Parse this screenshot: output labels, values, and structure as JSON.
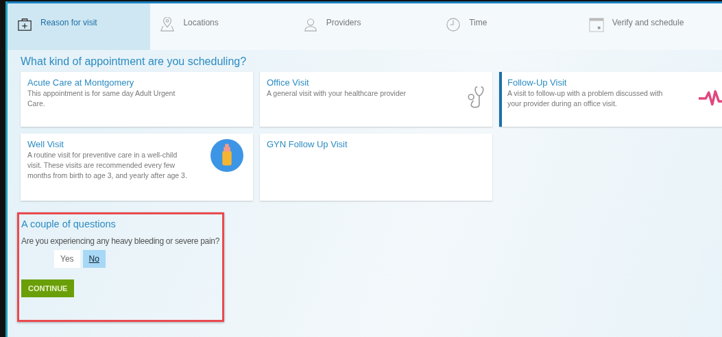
{
  "tabs": [
    {
      "label": "Reason for visit",
      "kind": "kit",
      "selected": true
    },
    {
      "label": "Locations",
      "kind": "pin",
      "selected": false
    },
    {
      "label": "Providers",
      "kind": "person",
      "selected": false
    },
    {
      "label": "Time",
      "kind": "clock",
      "selected": false
    },
    {
      "label": "Verify and schedule",
      "kind": "calendar",
      "selected": false
    }
  ],
  "heading": "What kind of appointment are you scheduling?",
  "appointment_types": [
    {
      "title": "Acute Care at Montgomery",
      "description": "This appointment is for same day Adult Urgent Care.",
      "kind": "plain",
      "selected": false
    },
    {
      "title": "Office Visit",
      "description": "A general visit with your healthcare provider",
      "kind": "stethoscope",
      "selected": false
    },
    {
      "title": "Follow-Up Visit",
      "description": "A visit to follow-up with a problem discussed with your provider during an office visit.",
      "kind": "pulse",
      "selected": true
    },
    {
      "title": "Well Visit",
      "description": "A routine visit for preventive care in a well-child visit. These visits are recommended every few months from birth to age 3, and yearly after age 3.",
      "kind": "bottle",
      "selected": false
    },
    {
      "title": "GYN Follow Up Visit",
      "kind": "plain",
      "selected": false
    }
  ],
  "questions": {
    "title": "A couple of questions",
    "question": "Are you experiencing any heavy bleeding or severe pain?",
    "answers": [
      {
        "label": "Yes",
        "selected": false
      },
      {
        "label": "No",
        "selected": true
      }
    ],
    "continue_button": "CONTINUE"
  }
}
